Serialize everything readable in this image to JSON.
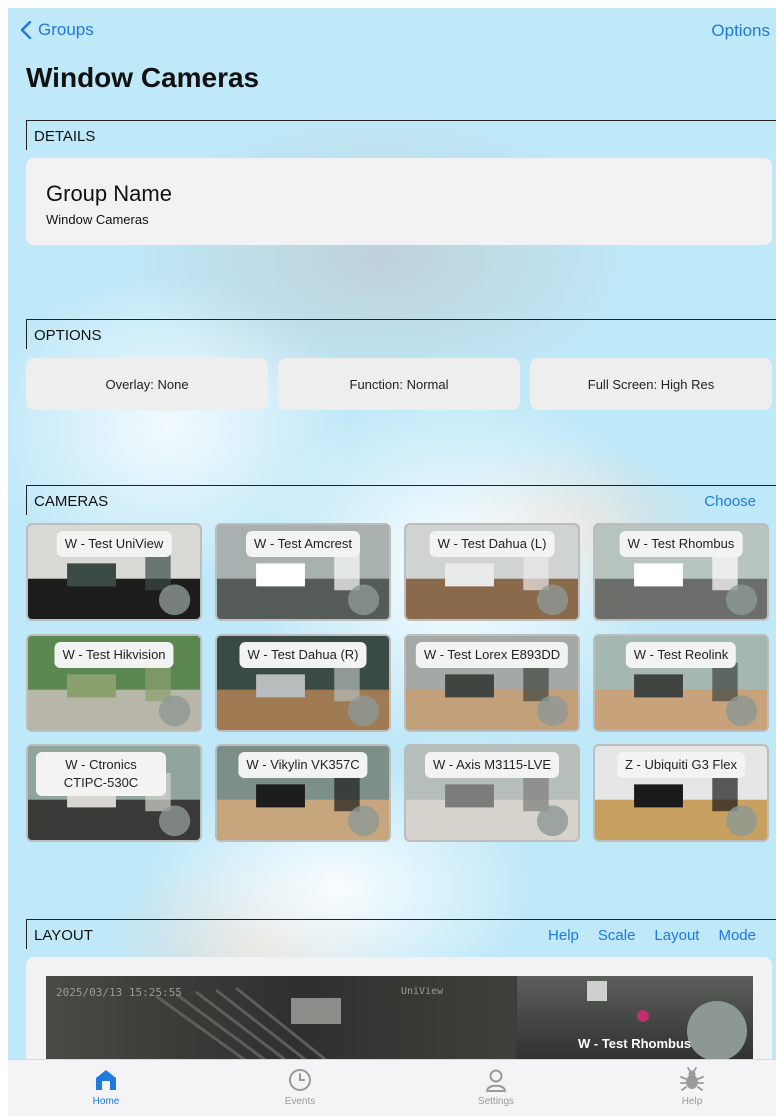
{
  "nav": {
    "back_label": "Groups",
    "options_label": "Options"
  },
  "title": "Window Cameras",
  "details": {
    "header": "DETAILS",
    "group_name_label": "Group Name",
    "group_name_value": "Window Cameras"
  },
  "options": {
    "header": "OPTIONS",
    "buttons": [
      "Overlay: None",
      "Function: Normal",
      "Full Screen: High Res"
    ]
  },
  "cameras": {
    "header": "CAMERAS",
    "choose_label": "Choose",
    "items": [
      {
        "name": "W - Test UniView"
      },
      {
        "name": "W - Test Amcrest"
      },
      {
        "name": "W - Test Dahua (L)"
      },
      {
        "name": "W - Test Rhombus"
      },
      {
        "name": "W - Test Hikvision"
      },
      {
        "name": "W - Test Dahua (R)"
      },
      {
        "name": "W - Test Lorex E893DD"
      },
      {
        "name": "W - Test Reolink"
      },
      {
        "name": "W - Ctronics CTIPC-530C"
      },
      {
        "name": "W - Vikylin VK357C"
      },
      {
        "name": "W - Axis M3115-LVE"
      },
      {
        "name": "Z - Ubiquiti G3 Flex"
      }
    ]
  },
  "layout": {
    "header": "LAYOUT",
    "actions": [
      "Help",
      "Scale",
      "Layout",
      "Mode"
    ],
    "preview_timestamp": "2025/03/13 15:25:55",
    "preview_cam_name": "UniView",
    "preview_right_label": "W - Test Rhombus"
  },
  "tabbar": {
    "tabs": [
      {
        "label": "Home",
        "icon": "home-icon",
        "active": true
      },
      {
        "label": "Events",
        "icon": "clock-icon",
        "active": false
      },
      {
        "label": "Settings",
        "icon": "person-icon",
        "active": false
      },
      {
        "label": "Help",
        "icon": "bug-icon",
        "active": false
      }
    ],
    "active_color": "#1f7ae0",
    "inactive_color": "#9a9a9a"
  }
}
